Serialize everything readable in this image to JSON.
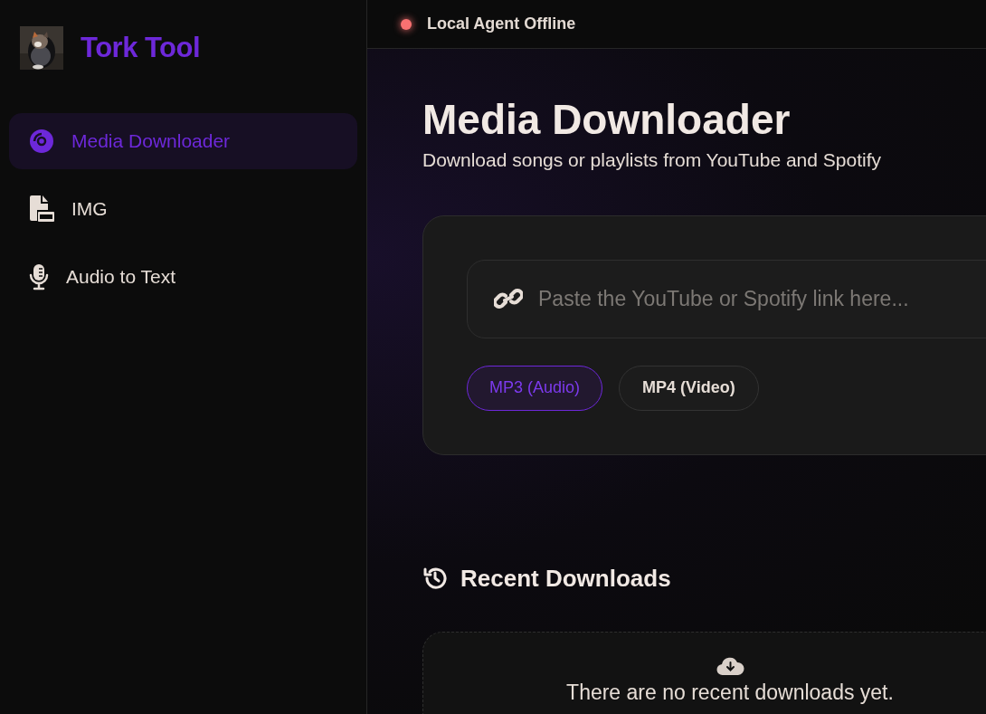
{
  "sidebar": {
    "brand": "Tork Tool",
    "items": [
      {
        "kind": "disc",
        "label": "Media Downloader",
        "selected": true
      },
      {
        "kind": "file",
        "label": "IMG",
        "selected": false
      },
      {
        "kind": "mic",
        "label": "Audio to Text",
        "selected": false
      }
    ]
  },
  "status": {
    "text": "Local Agent Offline",
    "online": false
  },
  "header": {
    "title": "Media Downloader",
    "subtitle": "Download songs or playlists from YouTube and Spotify"
  },
  "link_field": {
    "placeholder": "Paste the YouTube or Spotify link here..."
  },
  "formats": [
    {
      "label": "MP3 (Audio)",
      "selected": true
    },
    {
      "label": "MP4 (Video)",
      "selected": false
    }
  ],
  "recent": {
    "heading": "Recent Downloads",
    "empty_message": "There are no recent downloads yet."
  }
}
